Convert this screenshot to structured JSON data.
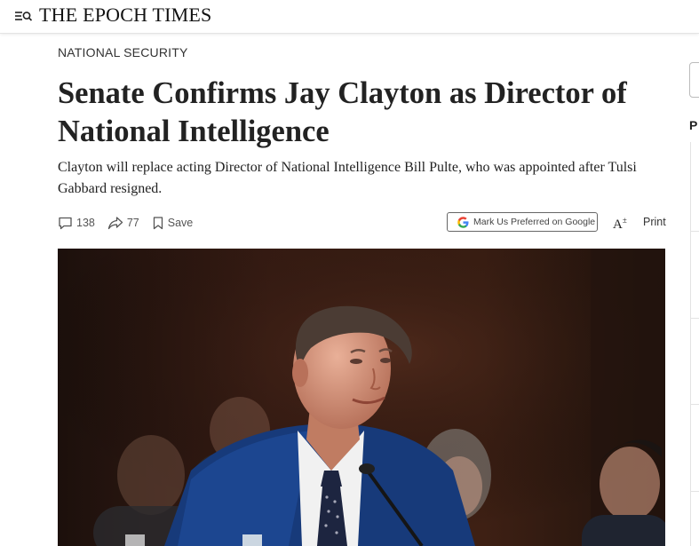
{
  "header": {
    "logo": "THE EPOCH TIMES",
    "menu_icon": "menu-search-icon"
  },
  "article": {
    "section": "NATIONAL SECURITY",
    "headline": "Senate Confirms Jay Clayton as Director of National Intelligence",
    "subhead": "Clayton will replace acting Director of National Intelligence Bill Pulte, who was appointed after Tulsi Gabbard resigned."
  },
  "actions": {
    "comments_count": "138",
    "shares_count": "77",
    "save_label": "Save",
    "google_label": "Mark Us Preferred on Google",
    "font_size_label": "A",
    "print_label": "Print"
  },
  "sidebar": {
    "heading_fragment": "P"
  },
  "colors": {
    "text": "#222222",
    "muted": "#555555",
    "border": "#e4e4e4"
  }
}
